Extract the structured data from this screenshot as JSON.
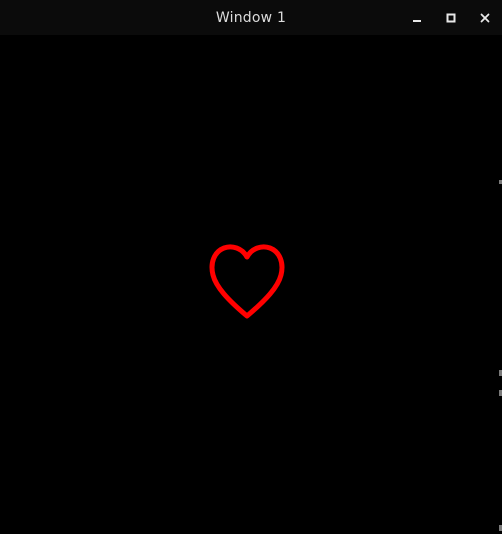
{
  "window": {
    "title": "Window 1"
  },
  "controls": {
    "minimize": "minimize-icon",
    "maximize": "maximize-icon",
    "close": "close-icon"
  },
  "canvas": {
    "background": "#000000",
    "shape": "heart-icon",
    "shape_color": "#ff0000"
  }
}
